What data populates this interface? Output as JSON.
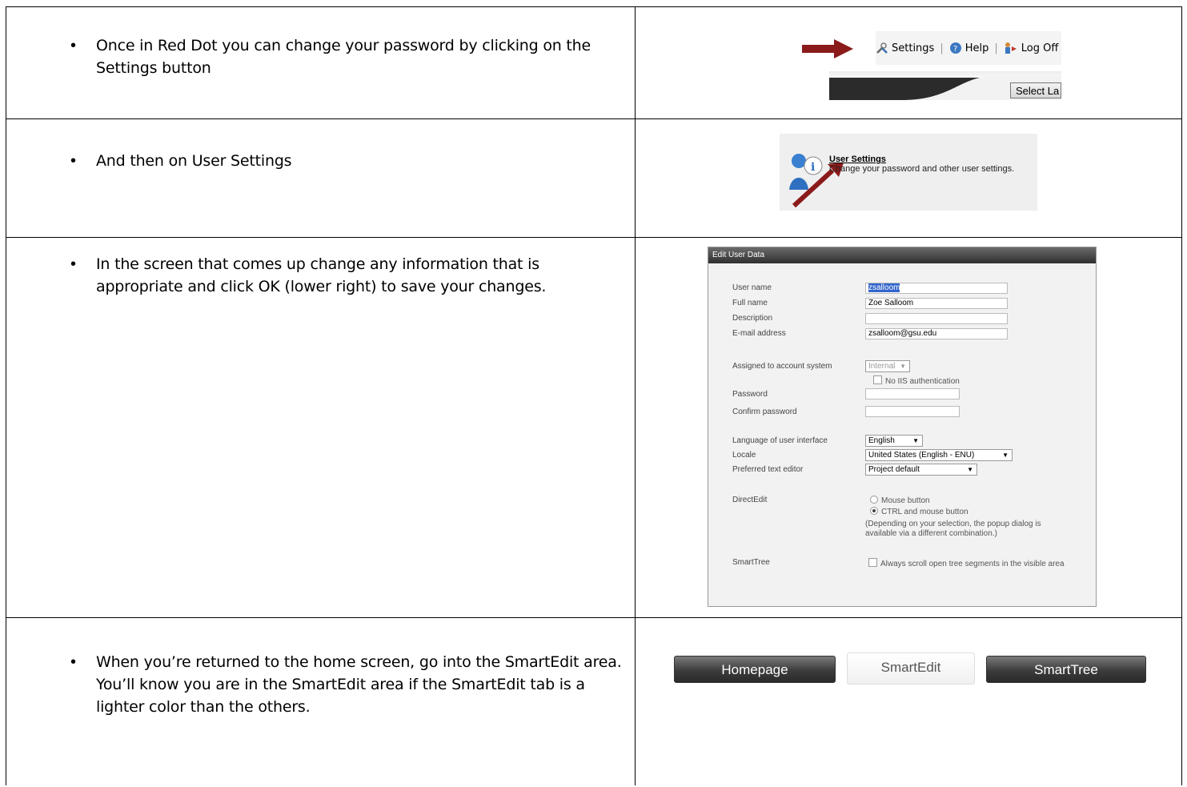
{
  "rows": [
    {
      "text": "Once in Red Dot you can change your password by clicking on the Settings button"
    },
    {
      "text": "And then on User Settings"
    },
    {
      "text": "In the screen that comes up change any information that is appropriate and click OK (lower right) to save your changes."
    },
    {
      "text": "When you’re returned to the home screen, go into the SmartEdit area.  You’ll know you are in the SmartEdit area if the SmartEdit tab is a lighter color than the others."
    }
  ],
  "toolbar": {
    "settings_label": "Settings",
    "help_label": "Help",
    "logoff_label": "Log Off",
    "separator": "|",
    "select_label": "Select La"
  },
  "user_settings": {
    "title": "User Settings",
    "description": "Change your password and other user settings."
  },
  "edit_user_data": {
    "header": "Edit User Data",
    "fields": {
      "user_name_label": "User name",
      "user_name_value": "zsalloom",
      "full_name_label": "Full name",
      "full_name_value": "Zoe Salloom",
      "description_label": "Description",
      "description_value": "",
      "email_label": "E-mail address",
      "email_value": "zsalloom@gsu.edu",
      "account_system_label": "Assigned to account system",
      "account_system_value": "Internal",
      "no_iis_label": "No IIS authentication",
      "password_label": "Password",
      "confirm_password_label": "Confirm password",
      "language_label": "Language of user interface",
      "language_value": "English",
      "locale_label": "Locale",
      "locale_value": "United States (English - ENU)",
      "editor_label": "Preferred text editor",
      "editor_value": "Project default",
      "directedit_label": "DirectEdit",
      "mouse_button_label": "Mouse button",
      "ctrl_mouse_label": "CTRL and mouse button",
      "directedit_note_1": "(Depending on your selection, the popup dialog is",
      "directedit_note_2": "available via a different combination.)",
      "smarttree_label": "SmartTree",
      "smarttree_option": "Always scroll open tree segments in the visible area"
    }
  },
  "tabs": [
    {
      "label": "Homepage",
      "active": false
    },
    {
      "label": "SmartEdit",
      "active": true
    },
    {
      "label": "SmartTree",
      "active": false
    }
  ],
  "colors": {
    "arrow": "#8b1a1a",
    "tab_dark": "#3c3c3c",
    "tab_light": "#f4f4f4"
  }
}
